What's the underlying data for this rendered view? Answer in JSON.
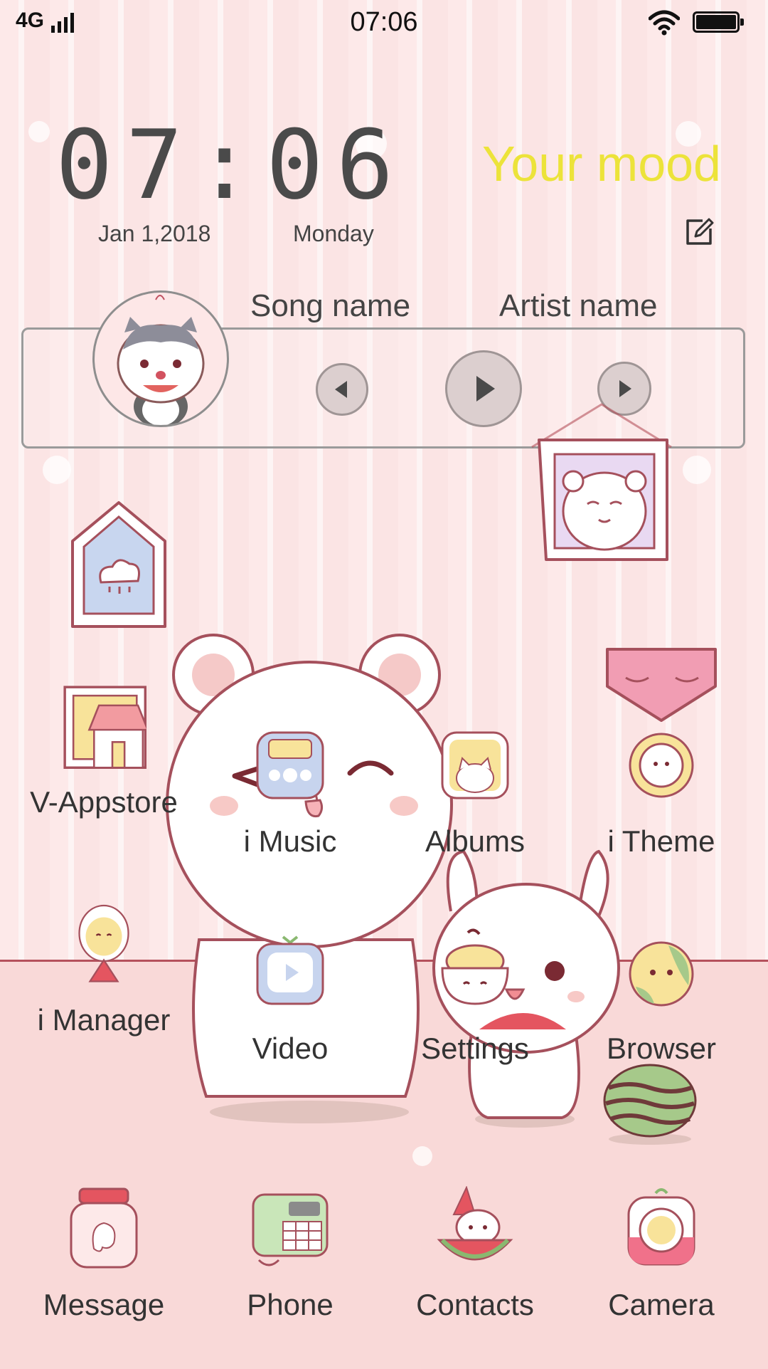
{
  "status_bar": {
    "network": "4G",
    "time": "07:06"
  },
  "clock_widget": {
    "time": "07:06",
    "date": "Jan 1,2018",
    "weekday": "Monday",
    "mood": "Your mood"
  },
  "music_widget": {
    "song": "Song name",
    "artist": "Artist name"
  },
  "apps": {
    "row1": [
      {
        "label": "V-Appstore",
        "icon": "appstore-house-icon"
      },
      {
        "label": "i Music",
        "icon": "music-player-icon"
      },
      {
        "label": "Albums",
        "icon": "cat-photo-icon"
      },
      {
        "label": "i Theme",
        "icon": "flower-banner-icon"
      }
    ],
    "row2": [
      {
        "label": "i Manager",
        "icon": "lemon-watermelon-icon"
      },
      {
        "label": "Video",
        "icon": "tv-icon"
      },
      {
        "label": "Settings",
        "icon": "noodle-bowl-icon"
      },
      {
        "label": "Browser",
        "icon": "planet-icon"
      }
    ],
    "dock": [
      {
        "label": "Message",
        "icon": "ghost-jar-icon"
      },
      {
        "label": "Phone",
        "icon": "telephone-icon"
      },
      {
        "label": "Contacts",
        "icon": "bunny-watermelon-icon"
      },
      {
        "label": "Camera",
        "icon": "camera-icon"
      }
    ]
  },
  "colors": {
    "wall": "#fde9e9",
    "floor": "#f9d9d8",
    "mood": "#ece33a",
    "outline": "#b5515c"
  }
}
